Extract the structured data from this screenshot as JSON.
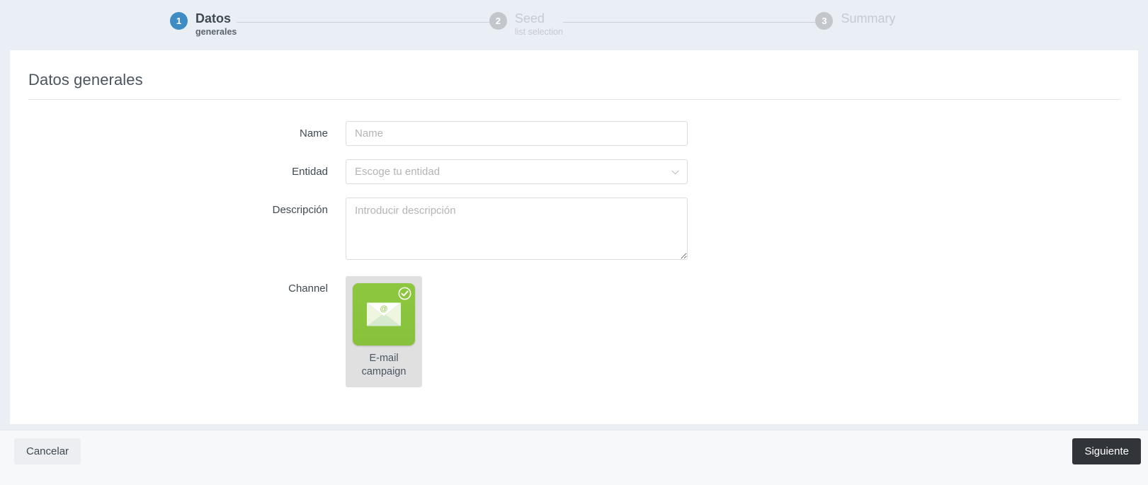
{
  "wizard": {
    "steps": [
      {
        "number": "1",
        "title": "Datos",
        "subtitle": "generales",
        "state": "active"
      },
      {
        "number": "2",
        "title": "Seed",
        "subtitle": "list selection",
        "state": "inactive"
      },
      {
        "number": "3",
        "title": "Summary",
        "subtitle": "",
        "state": "inactive"
      }
    ]
  },
  "card": {
    "title": "Datos generales"
  },
  "form": {
    "name": {
      "label": "Name",
      "placeholder": "Name",
      "value": ""
    },
    "entidad": {
      "label": "Entidad",
      "placeholder": "Escoge tu entidad",
      "selected": "Escoge tu entidad",
      "chevron_icon": "chevron-down-icon"
    },
    "descripcion": {
      "label": "Descripción",
      "placeholder": "Introducir descripción",
      "value": ""
    },
    "channel": {
      "label": "Channel",
      "options": [
        {
          "label_line1": "E-mail",
          "label_line2": "campaign",
          "icon": "envelope-at-icon",
          "selected": true,
          "badge_icon": "check-circle-icon"
        }
      ]
    }
  },
  "footer": {
    "cancel_label": "Cancelar",
    "next_label": "Siguiente"
  },
  "colors": {
    "page_background": "#eaeef5",
    "step_active": "#3d8dc4",
    "step_inactive": "#c3c6cb",
    "channel_green": "#8cc63f",
    "next_button": "#313439",
    "cancel_button": "#eceef2"
  }
}
